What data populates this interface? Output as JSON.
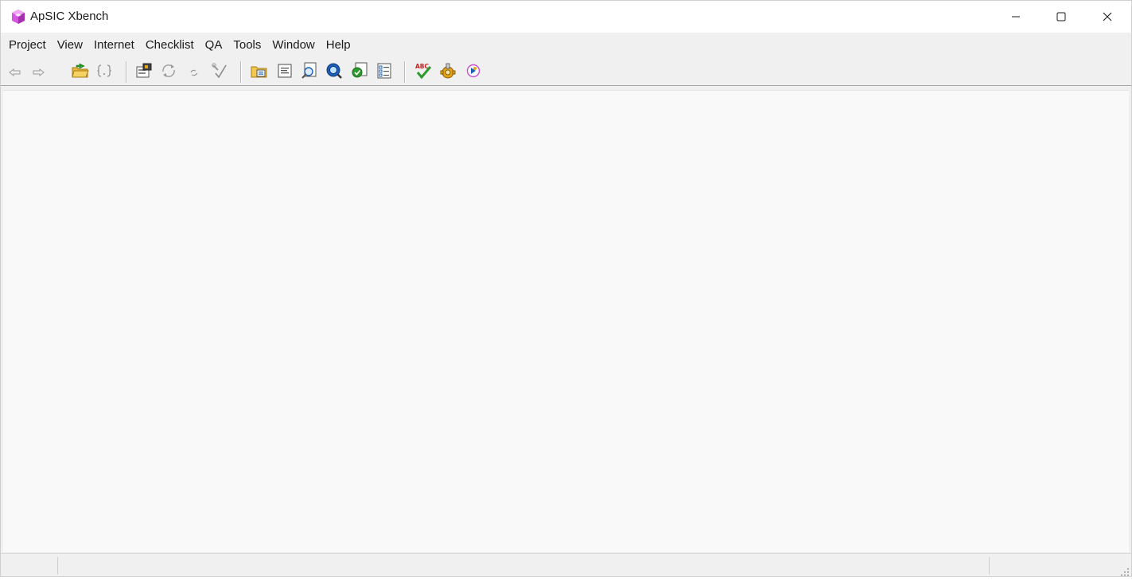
{
  "window": {
    "title": "ApSIC Xbench",
    "app_icon": "xbench-cube-icon",
    "controls": [
      "minimize-icon",
      "maximize-icon",
      "close-icon"
    ]
  },
  "menu": {
    "items": [
      "Project",
      "View",
      "Internet",
      "Checklist",
      "QA",
      "Tools",
      "Window",
      "Help"
    ]
  },
  "toolbar": {
    "buttons": [
      "back-arrow-icon",
      "forward-arrow-icon",
      "open-project-icon",
      "braces-icon",
      "project-properties-icon",
      "reload-icon",
      "refresh-small-icon",
      "check-tool-icon",
      "add-files-icon",
      "document-view-icon",
      "search-document-icon",
      "search-globe-icon",
      "qa-check-icon",
      "checklist-icon",
      "spellcheck-abc-icon",
      "settings-gear-icon",
      "help-about-icon"
    ],
    "colors": {
      "green": "#2e9a2e",
      "red": "#cc2020",
      "gold": "#e0a51c",
      "blue": "#1d5fb6"
    }
  },
  "statusbar": {
    "panes": [
      "",
      "",
      ""
    ]
  },
  "colors": {
    "title_bg": "#ffffff",
    "chrome_bg": "#f0f0f0",
    "workspace_bg": "#f9f9f9",
    "icon_magenta": "#c93fd1"
  }
}
